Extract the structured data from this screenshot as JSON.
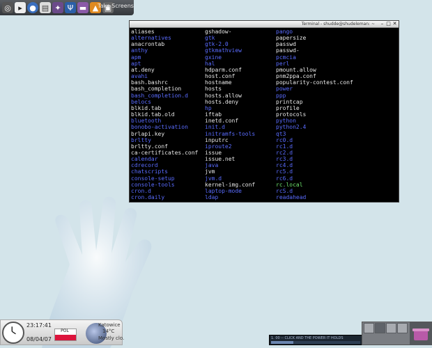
{
  "top_bar": {
    "icons": [
      "gnome-foot-icon",
      "terminal-icon",
      "globe-icon",
      "document-icon",
      "wand-icon",
      "psi-icon",
      "media-icon",
      "vlc-icon",
      "camera-icon"
    ],
    "take_screenshot_label": "Take Screens"
  },
  "terminal": {
    "title": "Terminal - shudde@shudeleman: ~",
    "columns": [
      [
        {
          "t": "aliases",
          "k": "f"
        },
        {
          "t": "alternatives",
          "k": "d"
        },
        {
          "t": "anacrontab",
          "k": "f"
        },
        {
          "t": "anthy",
          "k": "d"
        },
        {
          "t": "apm",
          "k": "d"
        },
        {
          "t": "apt",
          "k": "d"
        },
        {
          "t": "at.deny",
          "k": "f"
        },
        {
          "t": "avahi",
          "k": "d"
        },
        {
          "t": "bash.bashrc",
          "k": "f"
        },
        {
          "t": "bash_completion",
          "k": "f"
        },
        {
          "t": "bash_completion.d",
          "k": "d"
        },
        {
          "t": "belocs",
          "k": "d"
        },
        {
          "t": "blkid.tab",
          "k": "f"
        },
        {
          "t": "blkid.tab.old",
          "k": "f"
        },
        {
          "t": "bluetooth",
          "k": "d"
        },
        {
          "t": "bonobo-activation",
          "k": "d"
        },
        {
          "t": "brlapi.key",
          "k": "f"
        },
        {
          "t": "brltty",
          "k": "d"
        },
        {
          "t": "brltty.conf",
          "k": "f"
        },
        {
          "t": "ca-certificates.conf",
          "k": "f"
        },
        {
          "t": "calendar",
          "k": "d"
        },
        {
          "t": "cdrecord",
          "k": "d"
        },
        {
          "t": "chatscripts",
          "k": "d"
        },
        {
          "t": "console-setup",
          "k": "d"
        },
        {
          "t": "console-tools",
          "k": "d"
        },
        {
          "t": "cron.d",
          "k": "d"
        },
        {
          "t": "cron.daily",
          "k": "d"
        }
      ],
      [
        {
          "t": "gshadow-",
          "k": "f"
        },
        {
          "t": "gtk",
          "k": "d"
        },
        {
          "t": "gtk-2.0",
          "k": "d"
        },
        {
          "t": "gtkmathview",
          "k": "d"
        },
        {
          "t": "gxine",
          "k": "d"
        },
        {
          "t": "hal",
          "k": "d"
        },
        {
          "t": "hdparm.conf",
          "k": "f"
        },
        {
          "t": "host.conf",
          "k": "f"
        },
        {
          "t": "hostname",
          "k": "f"
        },
        {
          "t": "hosts",
          "k": "f"
        },
        {
          "t": "hosts.allow",
          "k": "f"
        },
        {
          "t": "hosts.deny",
          "k": "f"
        },
        {
          "t": "hp",
          "k": "d"
        },
        {
          "t": "iftab",
          "k": "f"
        },
        {
          "t": "inetd.conf",
          "k": "f"
        },
        {
          "t": "init.d",
          "k": "d"
        },
        {
          "t": "initramfs-tools",
          "k": "d"
        },
        {
          "t": "inputrc",
          "k": "f"
        },
        {
          "t": "iproute2",
          "k": "d"
        },
        {
          "t": "issue",
          "k": "f"
        },
        {
          "t": "issue.net",
          "k": "f"
        },
        {
          "t": "java",
          "k": "d"
        },
        {
          "t": "jvm",
          "k": "f"
        },
        {
          "t": "jvm.d",
          "k": "d"
        },
        {
          "t": "kernel-img.conf",
          "k": "f"
        },
        {
          "t": "laptop-mode",
          "k": "d"
        },
        {
          "t": "ldap",
          "k": "d"
        }
      ],
      [
        {
          "t": "pango",
          "k": "d"
        },
        {
          "t": "papersize",
          "k": "f"
        },
        {
          "t": "passwd",
          "k": "f"
        },
        {
          "t": "passwd-",
          "k": "f"
        },
        {
          "t": "pcmcia",
          "k": "d"
        },
        {
          "t": "perl",
          "k": "d"
        },
        {
          "t": "pmount.allow",
          "k": "f"
        },
        {
          "t": "pnm2ppa.conf",
          "k": "f"
        },
        {
          "t": "popularity-contest.conf",
          "k": "f"
        },
        {
          "t": "power",
          "k": "d"
        },
        {
          "t": "ppp",
          "k": "d"
        },
        {
          "t": "printcap",
          "k": "f"
        },
        {
          "t": "profile",
          "k": "f"
        },
        {
          "t": "protocols",
          "k": "f"
        },
        {
          "t": "python",
          "k": "d"
        },
        {
          "t": "python2.4",
          "k": "d"
        },
        {
          "t": "qt3",
          "k": "d"
        },
        {
          "t": "rc0.d",
          "k": "d"
        },
        {
          "t": "rc1.d",
          "k": "d"
        },
        {
          "t": "rc2.d",
          "k": "d"
        },
        {
          "t": "rc3.d",
          "k": "d"
        },
        {
          "t": "rc4.d",
          "k": "d"
        },
        {
          "t": "rc5.d",
          "k": "d"
        },
        {
          "t": "rc6.d",
          "k": "d"
        },
        {
          "t": "rc.local",
          "k": "g"
        },
        {
          "t": "rcS.d",
          "k": "d"
        },
        {
          "t": "readahead",
          "k": "d"
        }
      ]
    ],
    "colors": {
      "file": "#e8e8e8",
      "directory": "#5a6cff",
      "executable": "#6ce06c",
      "background": "#000000"
    }
  },
  "bottom_panel": {
    "time": "23:17:41",
    "date": "08/04/07",
    "keyboard_layout": "POL",
    "weather_lines": [
      "Katowice",
      "14°C",
      "Mostly clo."
    ]
  },
  "media_player": {
    "track_text": "1. 00 -- CLICK AND THE POWER IT HOLDS",
    "progress_fraction": 0.25
  },
  "pager": {
    "desktops": 4,
    "active_desktop": 2
  }
}
